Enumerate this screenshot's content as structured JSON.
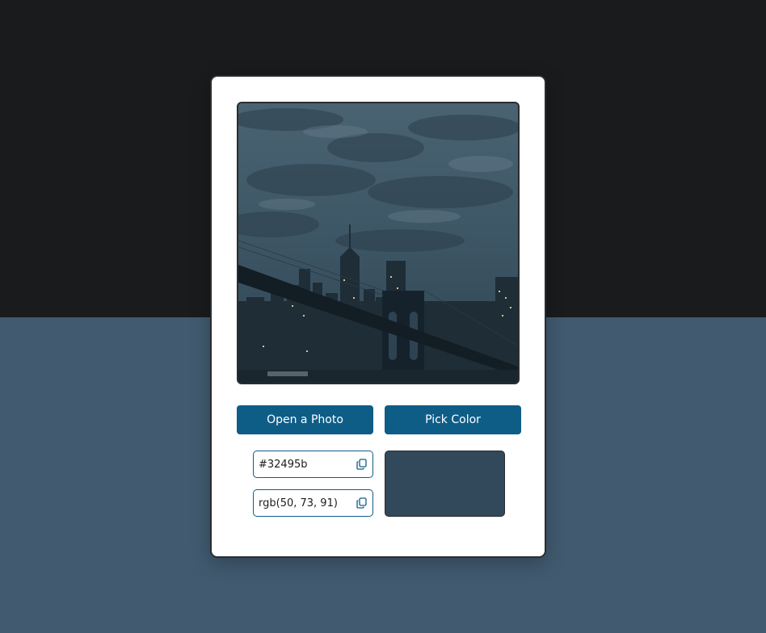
{
  "buttons": {
    "open_label": "Open a Photo",
    "pick_label": "Pick Color"
  },
  "color": {
    "hex": "#32495b",
    "rgb": "rgb(50, 73, 91)"
  },
  "icons": {
    "copy": "copy-icon"
  },
  "photo": {
    "subject": "city-skyline-bridge-photo"
  }
}
